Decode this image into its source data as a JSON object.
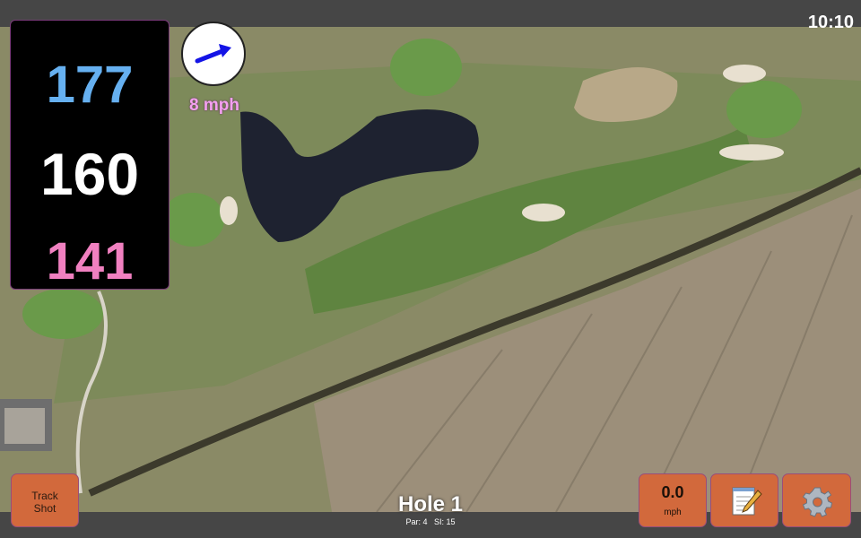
{
  "status_bar": {
    "time": "10:10"
  },
  "distances": {
    "back": "177",
    "middle": "160",
    "front": "141"
  },
  "wind": {
    "speed": "8 mph",
    "direction_icon": "arrow-right-icon"
  },
  "buttons": {
    "track_shot_line1": "Track",
    "track_shot_line2": "Shot",
    "speed_value": "0.0",
    "speed_unit": "mph",
    "notes_icon": "notepad-icon",
    "settings_icon": "gear-icon"
  },
  "hole": {
    "title": "Hole 1",
    "par_label": "Par: 4",
    "si_label": "SI: 15"
  },
  "colors": {
    "back_distance": "#66b0f0",
    "middle_distance": "#ffffff",
    "front_distance": "#f080c0",
    "wind_label": "#f4a0f0",
    "button_bg": "#d2693c",
    "bars": "#464646"
  }
}
